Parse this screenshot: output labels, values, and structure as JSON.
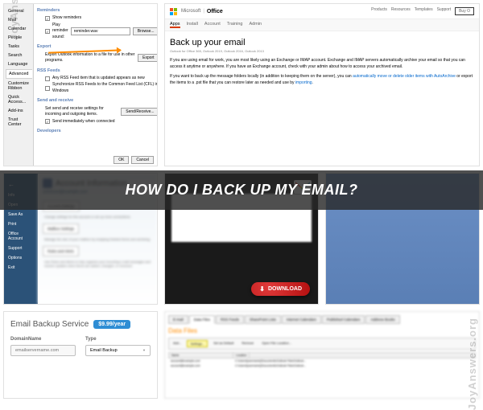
{
  "banner": {
    "question": "HOW DO I BACK UP MY EMAIL?"
  },
  "watermark": {
    "left": "JoyAnswers.org",
    "right": "JoyAnswers.org"
  },
  "t1": {
    "sidebar": [
      "General",
      "Mail",
      "Calendar",
      "People",
      "Tasks",
      "Search",
      "Language",
      "Advanced",
      "Customize Ribbon",
      "Quick Access...",
      "Add-ins",
      "Trust Center"
    ],
    "reminders_title": "Reminders",
    "show_reminders": "Show reminders",
    "play_reminder": "Play reminder sound:",
    "reminder_file": "reminder.wav",
    "browse": "Browse...",
    "export_title": "Export",
    "export_desc": "Export Outlook information to a file for use in other programs.",
    "export_btn": "Export",
    "rss_title": "RSS Feeds",
    "rss_1": "Any RSS Feed item that is updated appears as new",
    "rss_2": "Synchronize RSS Feeds to the Common Feed List (CFL) in Windows",
    "sendrec_title": "Send and receive",
    "sendrec_desc": "Set send and receive settings for incoming and outgoing items.",
    "sendrec_btn": "Send/Receive...",
    "sendrec_check": "Send immediately when connected",
    "dev_title": "Developers",
    "ok": "OK",
    "cancel": "Cancel"
  },
  "t2": {
    "brand_ms": "Microsoft",
    "brand_office": "Office",
    "nav": [
      "Products",
      "Resources",
      "Templates",
      "Support"
    ],
    "buy": "Buy O",
    "subnav": [
      "Apps",
      "Install",
      "Account",
      "Training",
      "Admin"
    ],
    "title": "Back up your email",
    "applies": "Outlook for Office 365, Outlook 2019, Outlook 2016, Outlook 2013",
    "para1": "If you are using email for work, you are most likely using an Exchange or IMAP account. Exchange and IMAP servers automatically archive your email so that you can access it anytime or anywhere. If you have an Exchange account, check with your admin about how to access your archived email.",
    "para2_a": "If you want to back up the message folders locally (in addition to keeping them on the server), you can ",
    "para2_link1": "automatically move or delete older items with AutoArchive",
    "para2_b": " or export the items to a .pst file that you can restore later as needed and use by ",
    "para2_link2": "importing",
    "para2_c": "."
  },
  "t4": {
    "sidebar": [
      "Info",
      "Open",
      "Save As",
      "Print",
      "Office Account",
      "Support",
      "Options",
      "Exit"
    ],
    "title": "Account Information",
    "email_label": "someone@example.com",
    "acct_settings": "Account Settings",
    "acct_desc": "Change settings for this account or set up more connections.",
    "mailbox": "Mailbox Settings",
    "mailbox_desc": "Manage the size of your mailbox by emptying Deleted Items and archiving.",
    "rules": "Rules and Alerts",
    "rules_desc": "Use Rules and Alerts to help organize your incoming e-mail messages and receive updates when items are added, changed, or removed."
  },
  "t5": {
    "download": "DOWNLOAD"
  },
  "t7": {
    "title": "Email Backup Service",
    "price": "$9.99/year",
    "domain_label": "DomainName",
    "domain_placeholder": "emailservername.com",
    "type_label": "Type",
    "type_value": "Email Backup"
  },
  "t8": {
    "tabs": [
      "E-mail",
      "Data Files",
      "RSS Feeds",
      "SharePoint Lists",
      "Internet Calendars",
      "Published Calendars",
      "Address Books"
    ],
    "title": "Data Files",
    "toolbar": [
      "Add...",
      "Settings...",
      "Set as Default",
      "Remove",
      "Open File Location..."
    ],
    "th": [
      "Name",
      "Location"
    ],
    "rows": [
      [
        "account@example.com",
        "C:\\Users\\[username]\\Documents\\Outlook Files\\Outlook..."
      ],
      [
        "account@example.com",
        "C:\\Users\\[username]\\Documents\\Outlook Files\\Outlook..."
      ]
    ]
  }
}
